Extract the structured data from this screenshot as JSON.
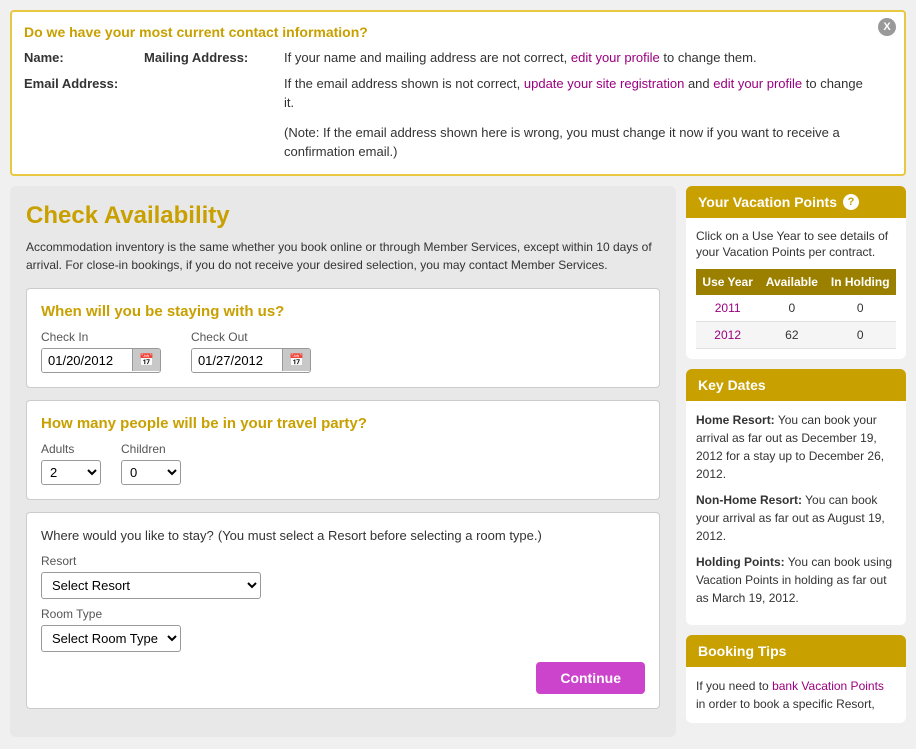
{
  "notice": {
    "title": "Do we have your most current contact information?",
    "close_label": "X",
    "name_label": "Name:",
    "mailing_label": "Mailing Address:",
    "email_label": "Email Address:",
    "mailing_text": "If your name and mailing address are not correct, ",
    "mailing_link": "edit your profile",
    "mailing_suffix": " to change them.",
    "email_text1": "If the email address shown is not correct, ",
    "email_link1": "update your site registration",
    "email_text2": " and ",
    "email_link2": "edit your profile",
    "email_suffix": " to change it.",
    "note": "(Note: If the email address shown here is wrong, you must change it now if you want to receive a confirmation email.)"
  },
  "left": {
    "title": "Check Availability",
    "description": "Accommodation inventory is the same whether you book online or through Member Services, except within 10 days of arrival. For close-in bookings, if you do not receive your desired selection, you may contact Member Services.",
    "section1_title": "When will you be staying with us?",
    "checkin_label": "Check In",
    "checkin_value": "01/20/2012",
    "checkout_label": "Check Out",
    "checkout_value": "01/27/2012",
    "section2_title": "How many people will be in your travel party?",
    "adults_label": "Adults",
    "children_label": "Children",
    "adults_value": "2",
    "children_value": "0",
    "section3_title": "Where would you like to stay?",
    "section3_subtitle": "(You must select a Resort before selecting a room type.)",
    "resort_label": "Resort",
    "resort_placeholder": "Select Resort",
    "room_type_label": "Room Type",
    "room_type_placeholder": "Select Room Type",
    "continue_label": "Continue"
  },
  "right": {
    "vp_title": "Your Vacation Points",
    "vp_desc": "Click on a Use Year to see details of your Vacation Points per contract.",
    "vp_col1": "Use Year",
    "vp_col2": "Available",
    "vp_col3": "In Holding",
    "vp_rows": [
      {
        "year": "2011",
        "available": "0",
        "holding": "0"
      },
      {
        "year": "2012",
        "available": "62",
        "holding": "0"
      }
    ],
    "key_dates_title": "Key Dates",
    "home_resort_label": "Home Resort:",
    "home_resort_text": "You can book your arrival as far out as December 19, 2012 for a stay up to December 26, 2012.",
    "non_home_label": "Non-Home Resort:",
    "non_home_text": "You can book your arrival as far out as August 19, 2012.",
    "holding_label": "Holding Points:",
    "holding_text": "You can book using Vacation Points in holding as far out as March 19, 2012.",
    "booking_tips_title": "Booking Tips",
    "booking_tips_link": "bank Vacation Points",
    "booking_tips_text": "If you need to bank Vacation Points in order to book a specific Resort,"
  }
}
